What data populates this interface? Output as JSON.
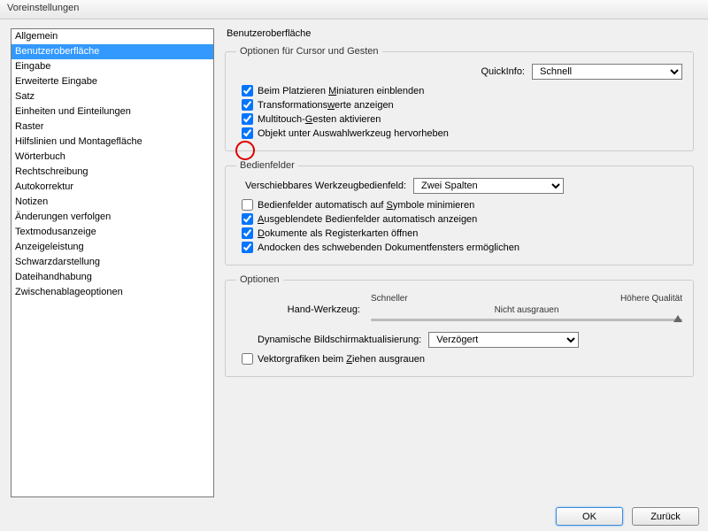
{
  "title": "Voreinstellungen",
  "sidebar": {
    "items": [
      {
        "label": "Allgemein"
      },
      {
        "label": "Benutzeroberfläche"
      },
      {
        "label": "Eingabe"
      },
      {
        "label": "Erweiterte Eingabe"
      },
      {
        "label": "Satz"
      },
      {
        "label": "Einheiten und Einteilungen"
      },
      {
        "label": "Raster"
      },
      {
        "label": "Hilfslinien und Montagefläche"
      },
      {
        "label": "Wörterbuch"
      },
      {
        "label": "Rechtschreibung"
      },
      {
        "label": "Autokorrektur"
      },
      {
        "label": "Notizen"
      },
      {
        "label": "Änderungen verfolgen"
      },
      {
        "label": "Textmodusanzeige"
      },
      {
        "label": "Anzeigeleistung"
      },
      {
        "label": "Schwarzdarstellung"
      },
      {
        "label": "Dateihandhabung"
      },
      {
        "label": "Zwischenablageoptionen"
      }
    ],
    "selected_index": 1
  },
  "main": {
    "heading": "Benutzeroberfläche",
    "group_cursor": {
      "legend": "Optionen für Cursor und Gesten",
      "quickinfo_label": "QuickInfo:",
      "quickinfo_value": "Schnell",
      "chk_thumbnails": {
        "checked": true,
        "pre": "Beim Platzieren ",
        "u": "M",
        "post": "iniaturen einblenden"
      },
      "chk_transform": {
        "checked": true,
        "pre": "Transformations",
        "u": "w",
        "post": "erte anzeigen"
      },
      "chk_multitouch": {
        "checked": true,
        "pre": "Multitouch-",
        "u": "G",
        "post": "esten aktivieren"
      },
      "chk_highlight": {
        "checked": true,
        "pre": "Objekt unter Auswahlwerkzeug hervorheben",
        "u": "",
        "post": ""
      }
    },
    "group_panels": {
      "legend": "Bedienfelder",
      "toolpanel_label": "Verschiebbares Werkzeugbedienfeld:",
      "toolpanel_value": "Zwei Spalten",
      "chk_minimize": {
        "checked": false,
        "pre": "Bedienfelder automatisch auf ",
        "u": "S",
        "post": "ymbole minimieren"
      },
      "chk_showhidden": {
        "checked": true,
        "pre": "",
        "u": "A",
        "post": "usgeblendete Bedienfelder automatisch anzeigen"
      },
      "chk_tabs": {
        "checked": true,
        "pre": "",
        "u": "D",
        "post": "okumente als Registerkarten öffnen"
      },
      "chk_dock": {
        "checked": true,
        "pre": "Andocken des schwebenden Dokumentfensters ermöglichen",
        "u": "",
        "post": ""
      }
    },
    "group_options": {
      "legend": "Optionen",
      "slider_left": "Schneller",
      "slider_right": "Höhere Qualität",
      "slider_sub": "Nicht ausgrauen",
      "hand_label": "Hand-Werkzeug:",
      "dyn_label": "Dynamische Bildschirmaktualisierung:",
      "dyn_value": "Verzögert",
      "chk_vector": {
        "checked": false,
        "pre": "Vektorgrafiken beim ",
        "u": "Z",
        "post": "iehen ausgrauen"
      }
    }
  },
  "buttons": {
    "ok": "OK",
    "cancel": "Zurück"
  }
}
